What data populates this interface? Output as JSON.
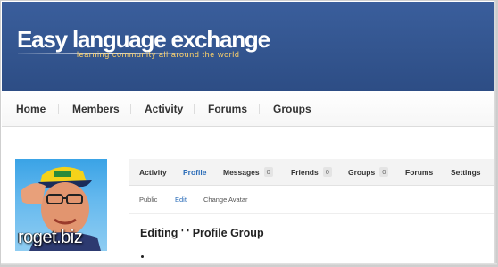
{
  "site": {
    "title": "Easy language exchange",
    "tagline": "learning community all around the world"
  },
  "main_nav": {
    "items": [
      {
        "label": "Home"
      },
      {
        "label": "Members"
      },
      {
        "label": "Activity"
      },
      {
        "label": "Forums"
      },
      {
        "label": "Groups"
      }
    ]
  },
  "profile": {
    "avatar_caption": "roget.biz",
    "nav": [
      {
        "label": "Activity",
        "active": false
      },
      {
        "label": "Profile",
        "active": true
      },
      {
        "label": "Messages",
        "count": "0"
      },
      {
        "label": "Friends",
        "count": "0"
      },
      {
        "label": "Groups",
        "count": "0"
      },
      {
        "label": "Forums"
      },
      {
        "label": "Settings"
      }
    ],
    "tabs": [
      {
        "label": "Public",
        "active": false
      },
      {
        "label": "Edit",
        "active": true
      },
      {
        "label": "Change Avatar",
        "active": false
      }
    ],
    "heading": "Editing ' ' Profile Group"
  },
  "colors": {
    "header_bg": "#33558f",
    "accent_link": "#2a6cb8",
    "tagline": "#ffd36a"
  }
}
